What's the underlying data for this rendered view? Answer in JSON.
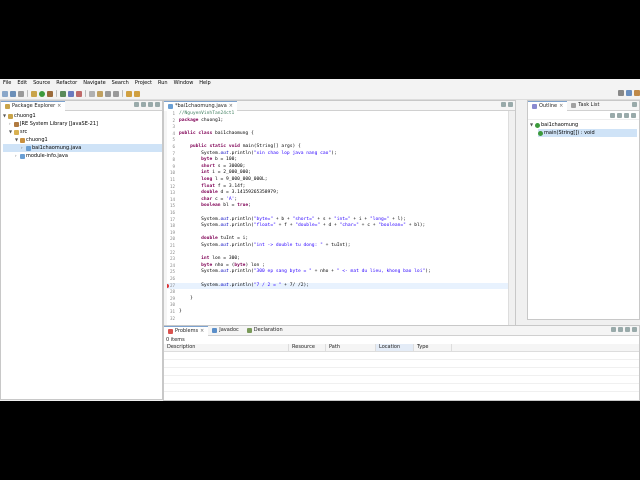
{
  "menu": [
    "File",
    "Edit",
    "Source",
    "Refactor",
    "Navigate",
    "Search",
    "Project",
    "Run",
    "Window",
    "Help"
  ],
  "package_explorer": {
    "title": "Package Explorer",
    "tree": [
      {
        "label": "chuong1",
        "depth": 0,
        "open": true,
        "icon": "project-icon"
      },
      {
        "label": "JRE System Library [JavaSE-21]",
        "depth": 1,
        "open": false,
        "icon": "library-icon"
      },
      {
        "label": "src",
        "depth": 1,
        "open": true,
        "icon": "folder-icon"
      },
      {
        "label": "chuong1",
        "depth": 2,
        "open": true,
        "icon": "package-icon"
      },
      {
        "label": "bai1chaomung.java",
        "depth": 3,
        "open": false,
        "icon": "java-file-icon",
        "selected": true
      },
      {
        "label": "module-info.java",
        "depth": 2,
        "open": false,
        "icon": "java-file-icon"
      }
    ]
  },
  "editor": {
    "tab_label": "*bai1chaomung.java",
    "lines": [
      {
        "n": "1",
        "t": "//NguyenVinhTan24ct1",
        "k": "cmt"
      },
      {
        "n": "2",
        "t": "package chuong1;",
        "k": "pkg"
      },
      {
        "n": "3",
        "t": "",
        "k": ""
      },
      {
        "n": "4",
        "t": "public class bai1chaomung {",
        "k": "cls"
      },
      {
        "n": "5",
        "t": "",
        "k": ""
      },
      {
        "n": "6",
        "t": "    public static void main(String[] args) {",
        "k": "main"
      },
      {
        "n": "7",
        "t": "        System.out.println(\"xin chao lop java nang cao\");",
        "k": "print"
      },
      {
        "n": "8",
        "t": "        byte b = 100;",
        "k": "decl"
      },
      {
        "n": "9",
        "t": "        short s = 30000;",
        "k": "decl"
      },
      {
        "n": "10",
        "t": "        int i = 2_000_000;",
        "k": "decl"
      },
      {
        "n": "11",
        "t": "        long l = 9_000_000_000L;",
        "k": "decl"
      },
      {
        "n": "12",
        "t": "        float f = 3.14f;",
        "k": "decl"
      },
      {
        "n": "13",
        "t": "        double d = 3.14159265358979;",
        "k": "decl"
      },
      {
        "n": "14",
        "t": "        char c = 'A';",
        "k": "decl"
      },
      {
        "n": "15",
        "t": "        boolean bl = true;",
        "k": "decl"
      },
      {
        "n": "16",
        "t": "",
        "k": ""
      },
      {
        "n": "17",
        "t": "        System.out.println(\"byte=\" + b + \"short=\" + s + \"int=\" + i + \"long=\" + l);",
        "k": "print"
      },
      {
        "n": "18",
        "t": "        System.out.println(\"float=\" + f + \"double=\" + d + \"char=\" + c + \"boolean=\" + bl);",
        "k": "print"
      },
      {
        "n": "19",
        "t": "",
        "k": ""
      },
      {
        "n": "20",
        "t": "        double tuInt = i;",
        "k": "decl"
      },
      {
        "n": "21",
        "t": "        System.out.println(\"int -> double tu dong: \" + tuInt);",
        "k": "print"
      },
      {
        "n": "22",
        "t": "",
        "k": ""
      },
      {
        "n": "23",
        "t": "        int lon = 300;",
        "k": "decl"
      },
      {
        "n": "24",
        "t": "        byte nho = (byte) lon ;",
        "k": "decl"
      },
      {
        "n": "25",
        "t": "        System.out.println(\"300 ep sang byte = \" + nho + \" <- mat du lieu, khong bao loi\");",
        "k": "print"
      },
      {
        "n": "26",
        "t": "",
        "k": ""
      },
      {
        "n": "27",
        "t": "        System.out.println(\"7 / 2 = \" + 7/ /2);",
        "k": "print",
        "current": true
      },
      {
        "n": "28",
        "t": "",
        "k": ""
      },
      {
        "n": "29",
        "t": "    }",
        "k": ""
      },
      {
        "n": "30",
        "t": "",
        "k": ""
      },
      {
        "n": "31",
        "t": "}",
        "k": ""
      },
      {
        "n": "32",
        "t": "",
        "k": ""
      }
    ]
  },
  "outline": {
    "title": "Outline",
    "task_list": "Task List",
    "class_name": "bai1chaomung",
    "method": "main(String[]) : void"
  },
  "bottom": {
    "tabs": [
      "Problems",
      "Javadoc",
      "Declaration"
    ],
    "status": "0 items",
    "columns": [
      "Description",
      "Resource",
      "Path",
      "Location",
      "Type"
    ]
  },
  "colors": {
    "keyword": "#7f0055",
    "string": "#2a00ff",
    "comment": "#3f7f5f",
    "field": "#0000c0"
  }
}
